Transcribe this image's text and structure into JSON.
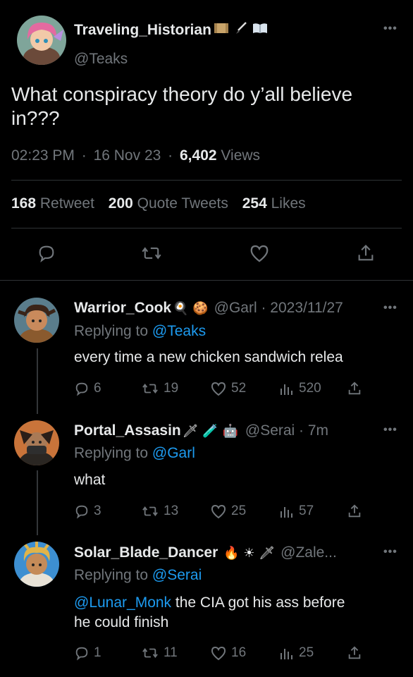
{
  "main_tweet": {
    "display_name": "Traveling_Historian",
    "name_emojis": [
      "scroll-icon",
      "brush-icon",
      "book-icon"
    ],
    "handle": "@Teaks",
    "text": "What conspiracy theory do y’all believe in???",
    "time": "02:23 PM",
    "date": "16 Nov 23",
    "views_count": "6,402",
    "views_label": "Views",
    "retweets": "168",
    "retweet_label": "Retweet",
    "quotes": "200",
    "quote_label": "Quote Tweets",
    "likes": "254",
    "likes_label": "Likes",
    "sep": "·"
  },
  "replies": [
    {
      "display_name": "Warrior_Cook",
      "emoji_text": "🍳 🍪",
      "handle_meta": "@Garl · 2023/11/27",
      "replying_prefix": "Replying to",
      "replying_to": "@Teaks",
      "text": "every time a new chicken sandwich relea",
      "replies": "6",
      "retweets": "19",
      "likes": "52",
      "views": "520"
    },
    {
      "display_name": "Portal_Assasin",
      "emoji_text": "🗡 🧪 🤖",
      "handle_meta": "@Serai · 7m",
      "replying_prefix": "Replying to",
      "replying_to": "@Garl",
      "text": "what",
      "replies": "3",
      "retweets": "13",
      "likes": "25",
      "views": "57"
    },
    {
      "display_name": "Solar_Blade_Dancer",
      "emoji_text": "🔥 ☀ 🗡",
      "handle_meta": "@Zale...",
      "replying_prefix": "Replying to",
      "replying_to": "@Serai",
      "mention": "@Lunar_Monk",
      "text_line1": " the CIA got his ass before",
      "text_line2": "he could finish",
      "replies": "1",
      "retweets": "11",
      "likes": "16",
      "views": "25"
    }
  ],
  "colors": {
    "background": "#000000",
    "text": "#e7e9ea",
    "muted": "#71767b",
    "link": "#1d9bf0",
    "divider": "#2f3336"
  }
}
